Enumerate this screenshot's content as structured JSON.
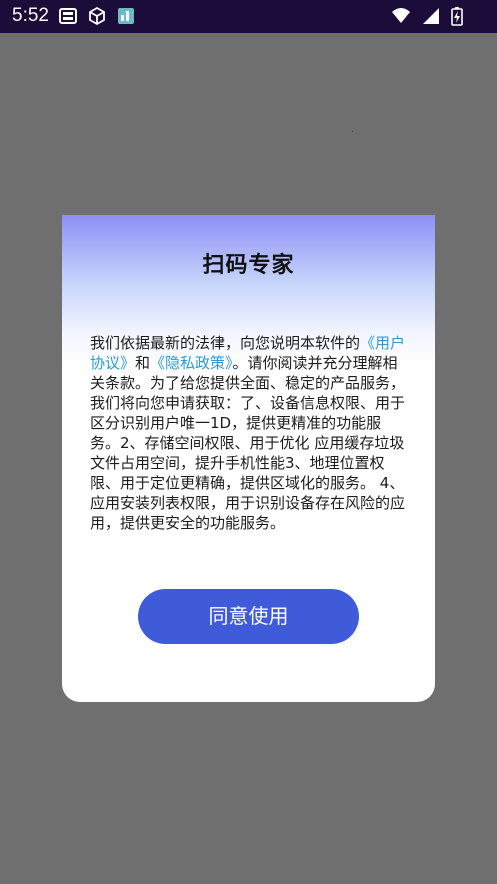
{
  "status_bar": {
    "time": "5:52",
    "left_icons": [
      "sim-card-icon",
      "cube-icon",
      "app-notification-icon"
    ],
    "right_icons": [
      "wifi-icon",
      "signal-icon",
      "battery-charging-icon"
    ]
  },
  "dialog": {
    "title": "扫码专家",
    "body_intro": "我们依据最新的法律，向您说明本软件的",
    "user_agreement_link": "《用户协议》",
    "and_text": "和",
    "privacy_policy_link": "《隐私政策》",
    "body_rest": "。请你阅读并充分理解相关条款。为了给您提供全面、稳定的产品服务，我们将向您申请获取：了、设备信息权限、用于区分识别用户唯一1D，提供更精准的功能服务。2、存储空间权限、用于优化 应用缓存垃圾文件占用空间，提升手机性能3、地理位置权限、用于定位更精确，提供区域化的服务。 4、应用安装列表权限，用于识别设备存在风险的应用，提供更安全的功能服务。",
    "agree_button": "同意使用"
  },
  "colors": {
    "status_bar": "#1b0c3a",
    "overlay": "#6f6f6f",
    "dialog_gradient_top": "#8d8ff6",
    "link": "#2a9bd8",
    "button": "#3f5bd9"
  }
}
